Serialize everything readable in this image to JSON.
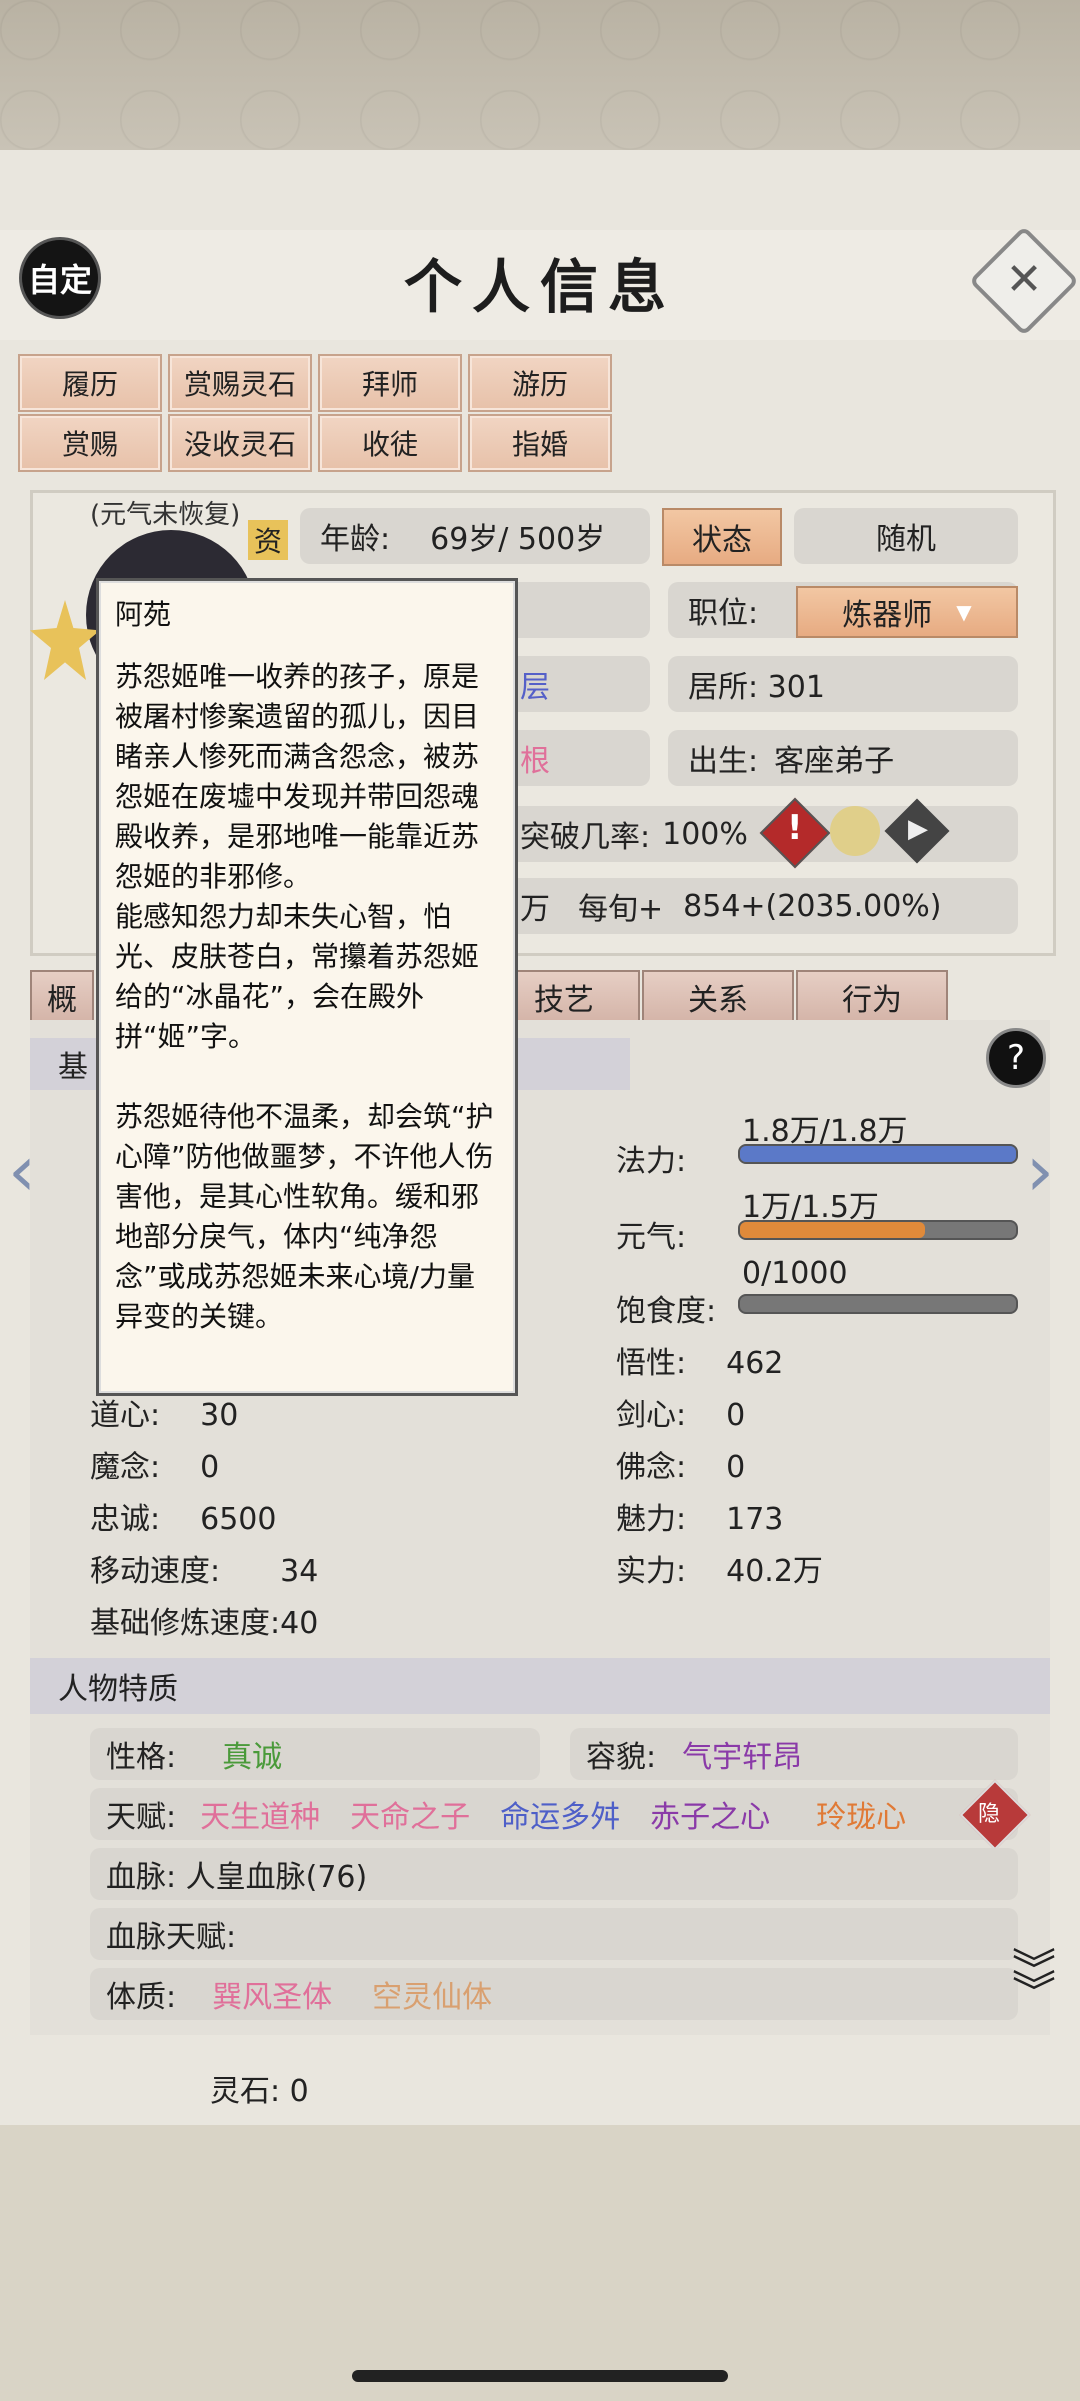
{
  "header": {
    "title": "个人信息",
    "left_badge": "自定"
  },
  "top_buttons": [
    "履历",
    "赏赐灵石",
    "拜师",
    "游历",
    "赏赐",
    "没收灵石",
    "收徒",
    "指婚"
  ],
  "profile": {
    "status_note": "(元气未恢复)",
    "aptitude_char": "资",
    "age_label": "年龄:",
    "age_value": "69岁/ 500岁",
    "state_button": "状态",
    "random_button": "随机",
    "job_label": "职位:",
    "job_value": "炼器师",
    "realm_partial": "层",
    "residence": "居所: 301",
    "root_partial": "根",
    "origin_label": "出生:",
    "origin_value": "客座弟子",
    "breakthrough_label": "突破几率:",
    "breakthrough_value": "100%",
    "wealth_unit": "万",
    "per_turn_label": "每旬+",
    "per_turn_value": "854+(2035.00%)"
  },
  "sub_tabs": [
    "概",
    "技艺",
    "关系",
    "行为"
  ],
  "section_basic": "基",
  "stats_left": [
    {
      "label": "道心:",
      "value": "30"
    },
    {
      "label": "魔念:",
      "value": "0"
    },
    {
      "label": "忠诚:",
      "value": "6500"
    },
    {
      "label": "移动速度:",
      "value": "34"
    },
    {
      "label": "基础修炼速度:",
      "value": "40"
    }
  ],
  "stats_right_bars": [
    {
      "label": "法力:",
      "text": "1.8万/1.8万",
      "fill": 1.0,
      "color": "#5b79c8"
    },
    {
      "label": "元气:",
      "text": "1万/1.5万",
      "fill": 0.67,
      "color": "#e08a3a"
    },
    {
      "label": "饱食度:",
      "text": "0/1000",
      "fill": 0.0,
      "color": "#999999"
    }
  ],
  "stats_right": [
    {
      "label": "悟性:",
      "value": "462"
    },
    {
      "label": "剑心:",
      "value": "0"
    },
    {
      "label": "佛念:",
      "value": "0"
    },
    {
      "label": "魅力:",
      "value": "173"
    },
    {
      "label": "实力:",
      "value": "40.2万"
    }
  ],
  "traits_section": "人物特质",
  "traits": {
    "personality_label": "性格:",
    "personality_value": "真诚",
    "looks_label": "容貌:",
    "looks_value": "气宇轩昂",
    "talent_label": "天赋:",
    "talents": [
      {
        "text": "天生道种",
        "color": "#e0709a"
      },
      {
        "text": "天命之子",
        "color": "#e0709a"
      },
      {
        "text": "命运多舛",
        "color": "#4e5fc8"
      },
      {
        "text": "赤子之心",
        "color": "#8a3aa8"
      },
      {
        "text": "玲珑心",
        "color": "#e07a36"
      }
    ],
    "hidden_badge": "隐",
    "bloodline": "血脉: 人皇血脉(76)",
    "bloodline_talent": "血脉天赋:",
    "physique_label": "体质:",
    "physique": [
      {
        "text": "巽风圣体",
        "color": "#e0709a"
      },
      {
        "text": "空灵仙体",
        "color": "#d9a070"
      }
    ]
  },
  "spirit_stone": "灵石: 0",
  "popup": {
    "name": "阿苑",
    "paragraph1": "苏怨姬唯一收养的孩子，原是被屠村惨案遗留的孤儿，因目睹亲人惨死而满含怨念，被苏怨姬在废墟中发现并带回怨魂殿收养，是邪地唯一能靠近苏怨姬的非邪修。",
    "paragraph2": "能感知怨力却未失心智，怕光、皮肤苍白，常攥着苏怨姬给的“冰晶花”，会在殿外拼“姬”字。",
    "paragraph3": "苏怨姬待他不温柔，却会筑“护心障”防他做噩梦，不许他人伤害他，是其心性软角。缓和邪地部分戾气，体内“纯净怨念”或成苏怨姬未来心境/力量异变的关键。"
  }
}
